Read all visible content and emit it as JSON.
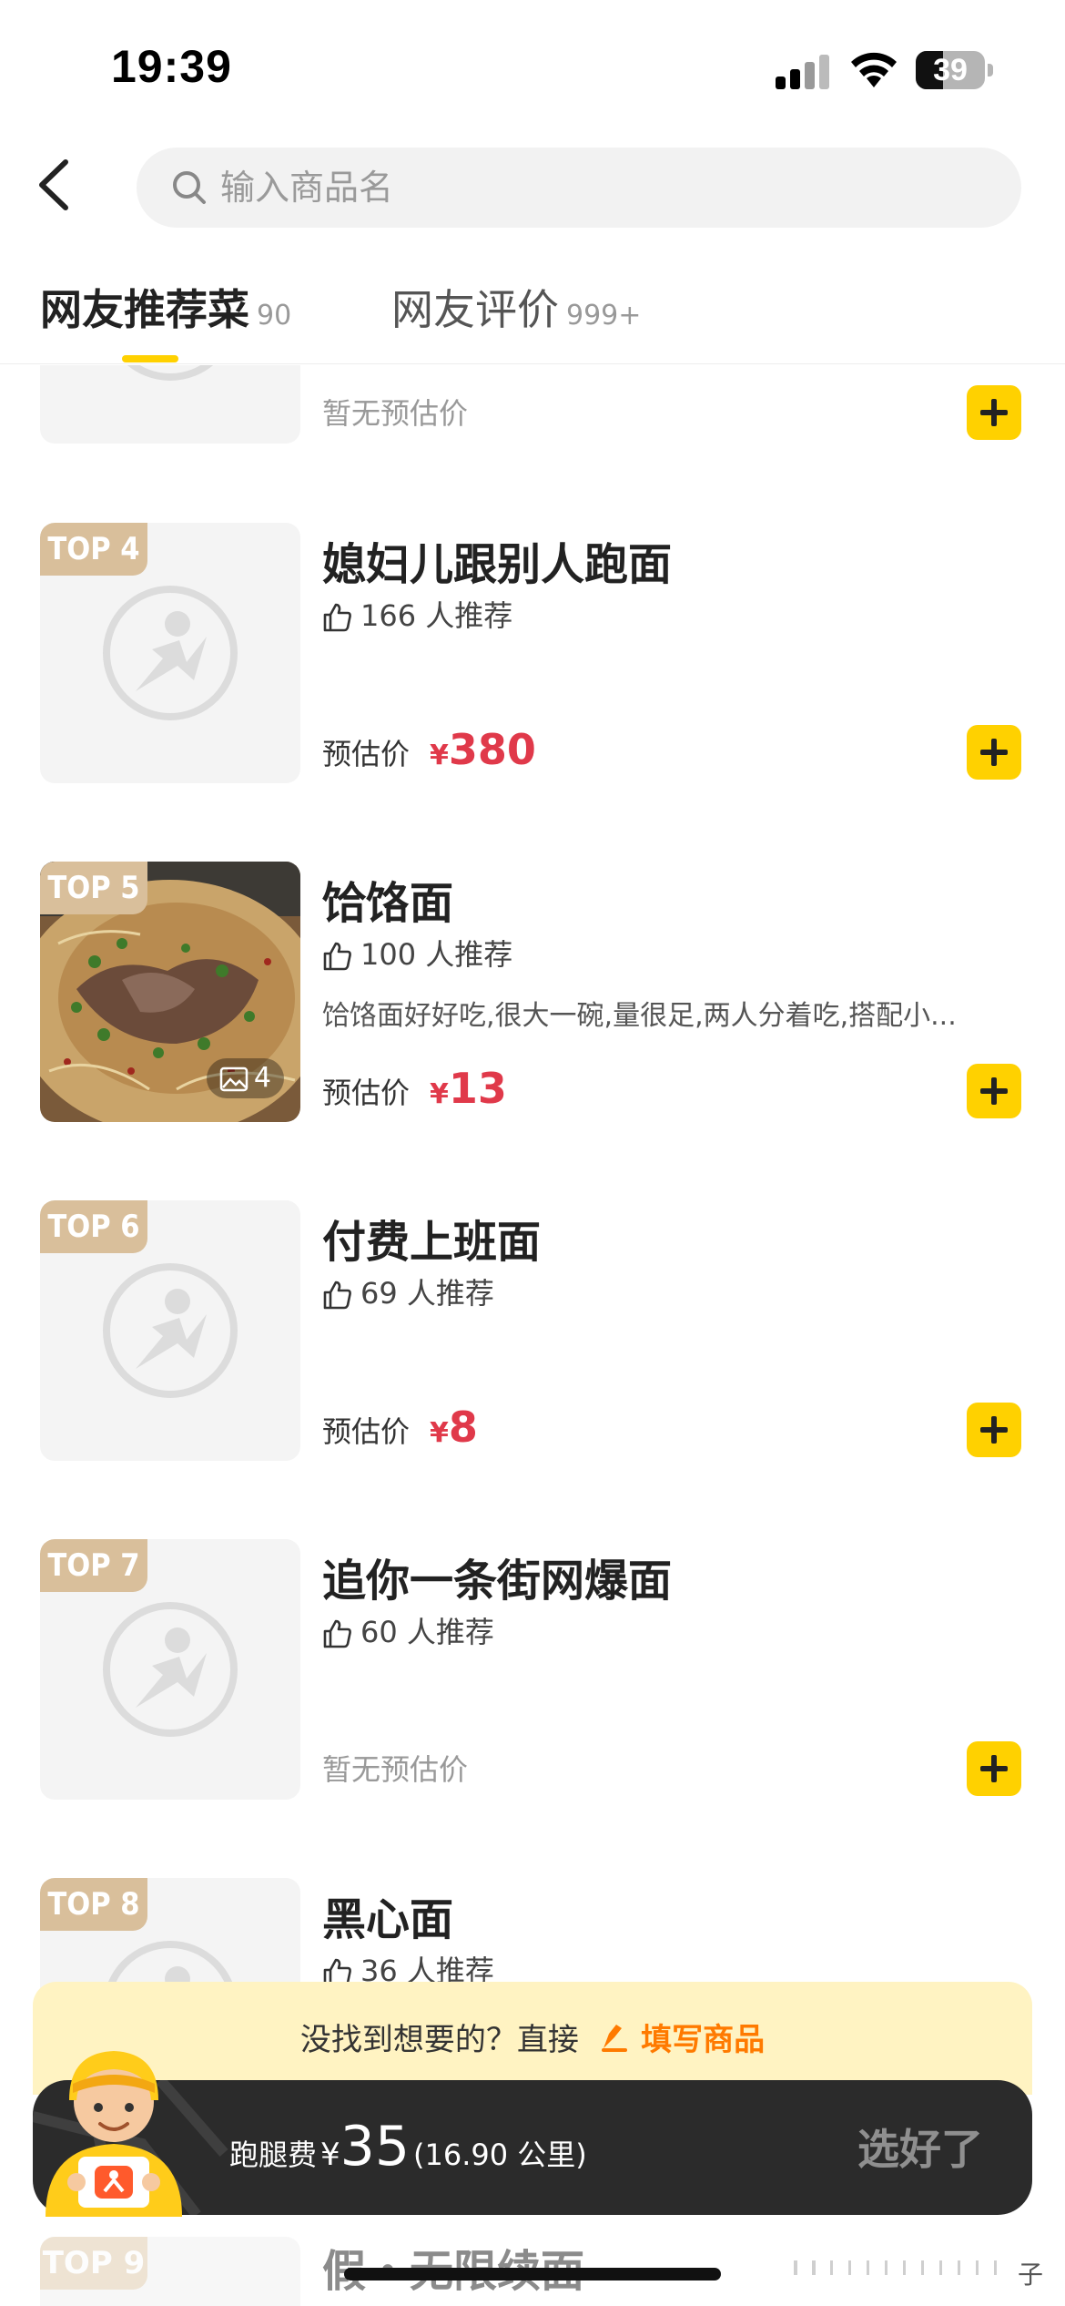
{
  "status_bar": {
    "time": "19:39",
    "battery": "39"
  },
  "search": {
    "placeholder": "输入商品名"
  },
  "tabs": [
    {
      "label": "网友推荐菜",
      "count": "90",
      "active": true
    },
    {
      "label": "网友评价",
      "count": "999+",
      "active": false
    }
  ],
  "items": [
    {
      "no_price": "暂无预估价"
    },
    {
      "badge": "TOP 4",
      "name": "媳妇儿跟别人跑面",
      "likes": "166 人推荐",
      "price_label": "预估价",
      "currency": "¥",
      "price": "380"
    },
    {
      "badge": "TOP 5",
      "name": "饸饹面",
      "likes": "100 人推荐",
      "review": "饸饹面好好吃,很大一碗,量很足,两人分着吃,搭配小...",
      "photo_count": "4",
      "price_label": "预估价",
      "currency": "¥",
      "price": "13"
    },
    {
      "badge": "TOP 6",
      "name": "付费上班面",
      "likes": "69 人推荐",
      "price_label": "预估价",
      "currency": "¥",
      "price": "8"
    },
    {
      "badge": "TOP 7",
      "name": "追你一条街网爆面",
      "likes": "60 人推荐",
      "no_price": "暂无预估价"
    },
    {
      "badge": "TOP 8",
      "name": "黑心面",
      "likes": "36 人推荐"
    },
    {
      "badge": "TOP 9",
      "name": "假・无限续面"
    }
  ],
  "bottom": {
    "not_found_text": "没找到想要的？直接",
    "fill_link": "填写商品",
    "fee_label": "跑腿费",
    "fee_currency": "¥",
    "fee_value": "35",
    "fee_distance": "(16.90 公里)",
    "done_label": "选好了",
    "peek_right": "子"
  },
  "colors": {
    "accent": "#ffd100",
    "price": "#e0394a",
    "link": "#ff7a00",
    "badge": "#d9bf9b"
  }
}
